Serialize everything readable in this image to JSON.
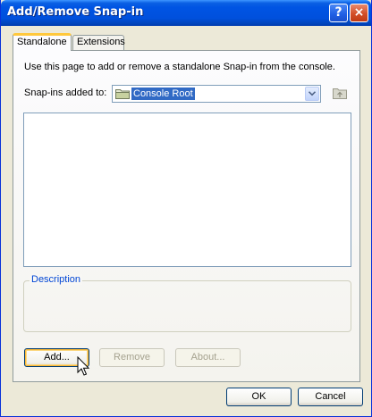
{
  "window": {
    "title": "Add/Remove Snap-in",
    "help_label": "?",
    "close_label": "×"
  },
  "tabs": [
    {
      "label": "Standalone",
      "active": true
    },
    {
      "label": "Extensions",
      "active": false
    }
  ],
  "standalone": {
    "description": "Use this page to add or remove a standalone Snap-in from the console.",
    "snapins_label": "Snap-ins added to:",
    "combo_value": "Console Root",
    "combo_icon": "folder-icon",
    "up_icon": "folder-up-icon",
    "list_items": [],
    "group_label": "Description",
    "group_text": ""
  },
  "buttons": {
    "add": "Add...",
    "remove": "Remove",
    "about": "About...",
    "ok": "OK",
    "cancel": "Cancel"
  },
  "colors": {
    "title_bar": "#0054e3",
    "selection": "#316ac5",
    "group_label": "#0046d5",
    "tab_highlight": "#ffc83c"
  }
}
